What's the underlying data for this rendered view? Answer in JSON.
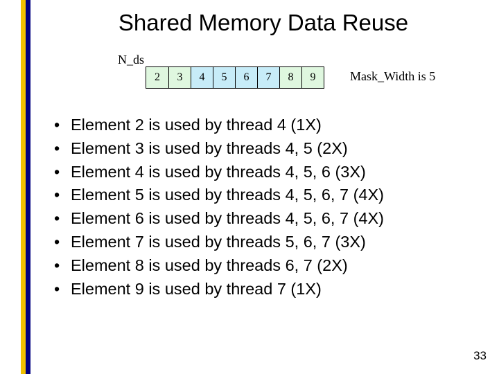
{
  "title": "Shared Memory Data Reuse",
  "nds_label": "N_ds",
  "mask_label": "Mask_Width is 5",
  "cells": [
    {
      "value": "2",
      "kind": "halo"
    },
    {
      "value": "3",
      "kind": "halo"
    },
    {
      "value": "4",
      "kind": "core"
    },
    {
      "value": "5",
      "kind": "core"
    },
    {
      "value": "6",
      "kind": "core"
    },
    {
      "value": "7",
      "kind": "core"
    },
    {
      "value": "8",
      "kind": "halo"
    },
    {
      "value": "9",
      "kind": "halo"
    }
  ],
  "bullets": [
    "Element 2 is used by thread 4 (1X)",
    "Element 3 is used by threads 4, 5 (2X)",
    "Element 4 is used by threads 4, 5, 6 (3X)",
    "Element 5 is used by threads 4, 5, 6, 7 (4X)",
    "Element 6 is used by threads 4, 5, 6, 7 (4X)",
    "Element 7 is used by threads 5, 6, 7 (3X)",
    "Element 8 is used by threads 6, 7 (2X)",
    "Element 9 is used by thread 7 (1X)"
  ],
  "page_number": "33",
  "bullet_char": "•"
}
